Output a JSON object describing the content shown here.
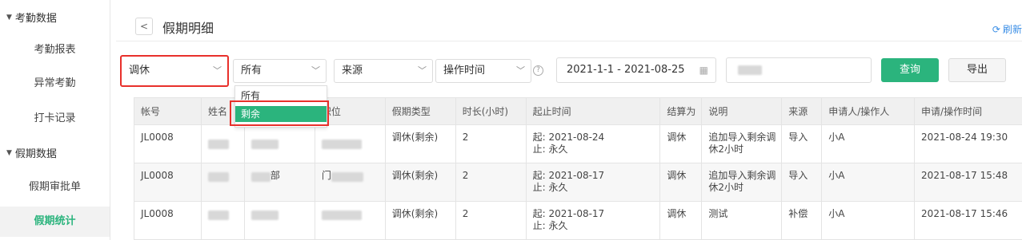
{
  "sidebar": {
    "group1": "考勤数据",
    "items1": [
      "考勤报表",
      "异常考勤",
      "打卡记录"
    ],
    "group2": "假期数据",
    "items2": [
      "假期审批单",
      "假期统计"
    ],
    "active": "假期统计"
  },
  "header": {
    "back": "<",
    "title": "假期明细",
    "refresh": "刷新"
  },
  "filters": {
    "type": "调休",
    "status": "所有",
    "source": "来源",
    "time_type": "操作时间",
    "date_range": "2021-1-1 - 2021-08-25",
    "query": "查询",
    "export": "导出"
  },
  "dropdown": {
    "options": [
      "所有",
      "剩余"
    ],
    "selected": "剩余"
  },
  "table": {
    "headers": [
      "帐号",
      "姓名",
      "",
      "职位",
      "假期类型",
      "时长(小时)",
      "起止时间",
      "结算为",
      "说明",
      "来源",
      "申请人/操作人",
      "申请/操作时间"
    ],
    "rows": [
      {
        "account": "JL0008",
        "dept_suffix": "",
        "pos_prefix": "",
        "type": "调休(剩余)",
        "hours": "2",
        "start": "起: 2021-08-24",
        "end": "止: 永久",
        "settle": "调休",
        "desc": "追加导入剩余调休2小时",
        "source": "导入",
        "applicant": "小A",
        "time": "2021-08-24 19:30"
      },
      {
        "account": "JL0008",
        "dept_suffix": "部",
        "pos_prefix": "门",
        "type": "调休(剩余)",
        "hours": "2",
        "start": "起: 2021-08-17",
        "end": "止: 永久",
        "settle": "调休",
        "desc": "追加导入剩余调休2小时",
        "source": "导入",
        "applicant": "小A",
        "time": "2021-08-17 15:48"
      },
      {
        "account": "JL0008",
        "dept_suffix": "",
        "pos_prefix": "",
        "type": "调休(剩余)",
        "hours": "2",
        "start": "起: 2021-08-17",
        "end": "止: 永久",
        "settle": "调休",
        "desc": "测试",
        "source": "补偿",
        "applicant": "小A",
        "time": "2021-08-17 15:46"
      }
    ]
  },
  "colors": {
    "accent": "#2bb47d",
    "highlight": "#e8302b",
    "link": "#3a8ee6"
  }
}
